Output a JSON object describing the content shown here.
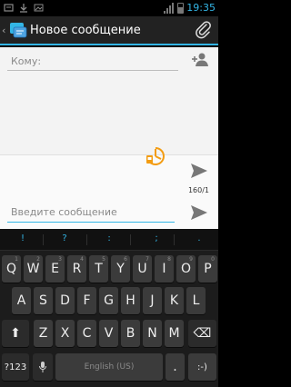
{
  "status_bar": {
    "time": "19:35"
  },
  "action_bar": {
    "back_glyph": "‹",
    "title": "Новое сообщение",
    "app_icon": "messaging-icon",
    "attach_icon": "paperclip-icon"
  },
  "recipients": {
    "placeholder": "Кому:",
    "add_icon": "add-contact-icon"
  },
  "compose": {
    "placeholder": "Введите сообщение",
    "counter": "160/1",
    "send_icon": "send-icon",
    "sim_icon": "sim-badge-icon"
  },
  "colors": {
    "accent": "#33b5e5",
    "sim_orange": "#f39c12"
  },
  "keyboard": {
    "suggestions": [
      "!",
      "?",
      ":",
      ";",
      "."
    ],
    "row1": [
      {
        "label": "Q",
        "sub": "1"
      },
      {
        "label": "W",
        "sub": "2"
      },
      {
        "label": "E",
        "sub": "3"
      },
      {
        "label": "R",
        "sub": "4"
      },
      {
        "label": "T",
        "sub": "5"
      },
      {
        "label": "Y",
        "sub": "6"
      },
      {
        "label": "U",
        "sub": "7"
      },
      {
        "label": "I",
        "sub": "8"
      },
      {
        "label": "O",
        "sub": "9"
      },
      {
        "label": "P",
        "sub": "0"
      }
    ],
    "row2": [
      "A",
      "S",
      "D",
      "F",
      "G",
      "H",
      "J",
      "K",
      "L"
    ],
    "row3": [
      "Z",
      "X",
      "C",
      "V",
      "B",
      "N",
      "M"
    ],
    "shift_glyph": "⬆",
    "backspace_glyph": "⌫",
    "sym_label": "?123",
    "mic_glyph": "🎤",
    "space_label": "English (US)",
    "period_label": ".",
    "smiley_label": ":-)"
  }
}
